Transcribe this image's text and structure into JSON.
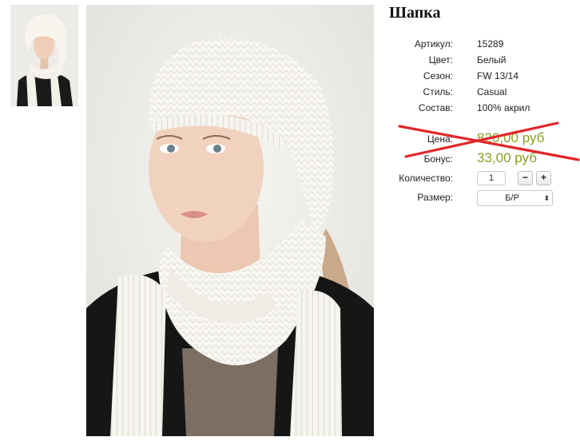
{
  "product": {
    "title": "Шапка",
    "attributes": [
      {
        "label": "Артикул:",
        "value": "15289"
      },
      {
        "label": "Цвет:",
        "value": "Белый"
      },
      {
        "label": "Сезон:",
        "value": "FW 13/14"
      },
      {
        "label": "Стиль:",
        "value": "Casual"
      },
      {
        "label": "Состав:",
        "value": "100% акрил"
      }
    ],
    "price_label": "Цена:",
    "price_value": "820,00 руб",
    "bonus_label": "Бонус:",
    "bonus_value": "33,00 руб",
    "quantity_label": "Количество:",
    "quantity_value": "1",
    "minus_label": "−",
    "plus_label": "+",
    "size_label": "Размер:",
    "size_value": "Б/Р",
    "size_arrow": "⬍"
  },
  "colors": {
    "price": "#8aa124",
    "strike": "#e2262b"
  },
  "icons": {
    "strike_mark": "red-cross-strike"
  }
}
